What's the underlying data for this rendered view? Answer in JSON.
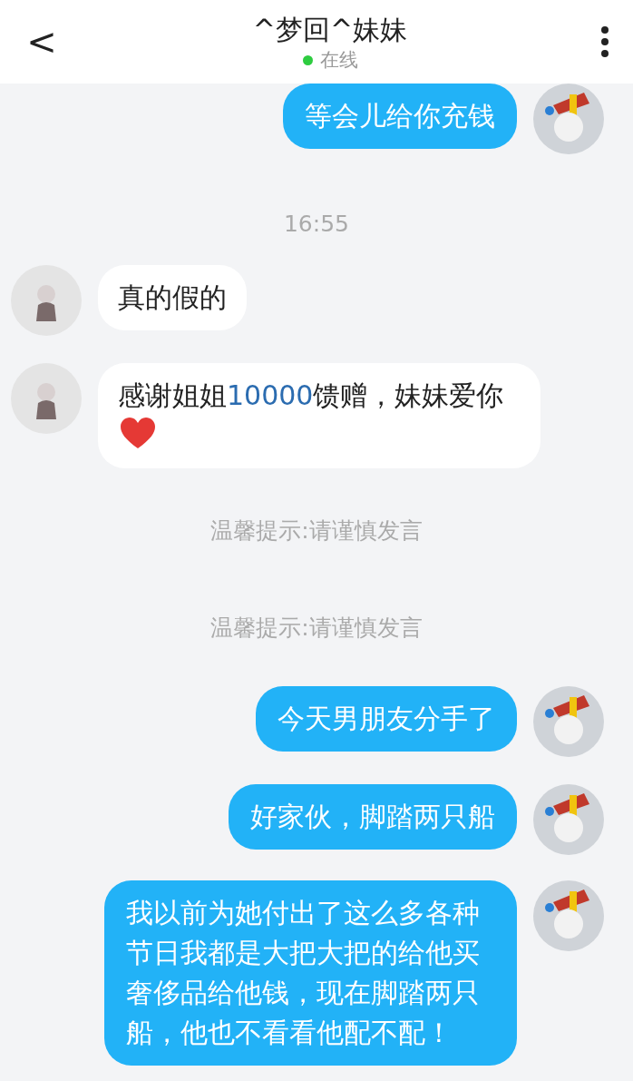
{
  "header": {
    "back": "<",
    "title": "^梦回^妹妹",
    "status": "在线",
    "online": true
  },
  "messages": [
    {
      "kind": "sent",
      "parts": [
        {
          "kind": "text",
          "text": "等会儿给你充钱"
        }
      ]
    },
    {
      "kind": "time",
      "text": "16:55"
    },
    {
      "kind": "received",
      "parts": [
        {
          "kind": "text",
          "text": "真的假的"
        }
      ]
    },
    {
      "kind": "received",
      "parts": [
        {
          "kind": "text",
          "text": "感谢姐姐"
        },
        {
          "kind": "number",
          "text": "10000"
        },
        {
          "kind": "text",
          "text": "馈赠，妹妹爱你"
        },
        {
          "kind": "heart"
        }
      ]
    },
    {
      "kind": "notice",
      "text": "温馨提示:请谨慎发言"
    },
    {
      "kind": "notice",
      "text": "温馨提示:请谨慎发言"
    },
    {
      "kind": "sent",
      "parts": [
        {
          "kind": "text",
          "text": "今天男朋友分手了"
        }
      ]
    },
    {
      "kind": "sent",
      "parts": [
        {
          "kind": "text",
          "text": "好家伙，脚踏两只船"
        }
      ]
    },
    {
      "kind": "sent",
      "parts": [
        {
          "kind": "text",
          "text": "我以前为她付出了这么多各种节日我都是大把大把的给他买奢侈品给他钱，现在脚踏两只船，他也不看看他配不配！"
        }
      ]
    }
  ]
}
